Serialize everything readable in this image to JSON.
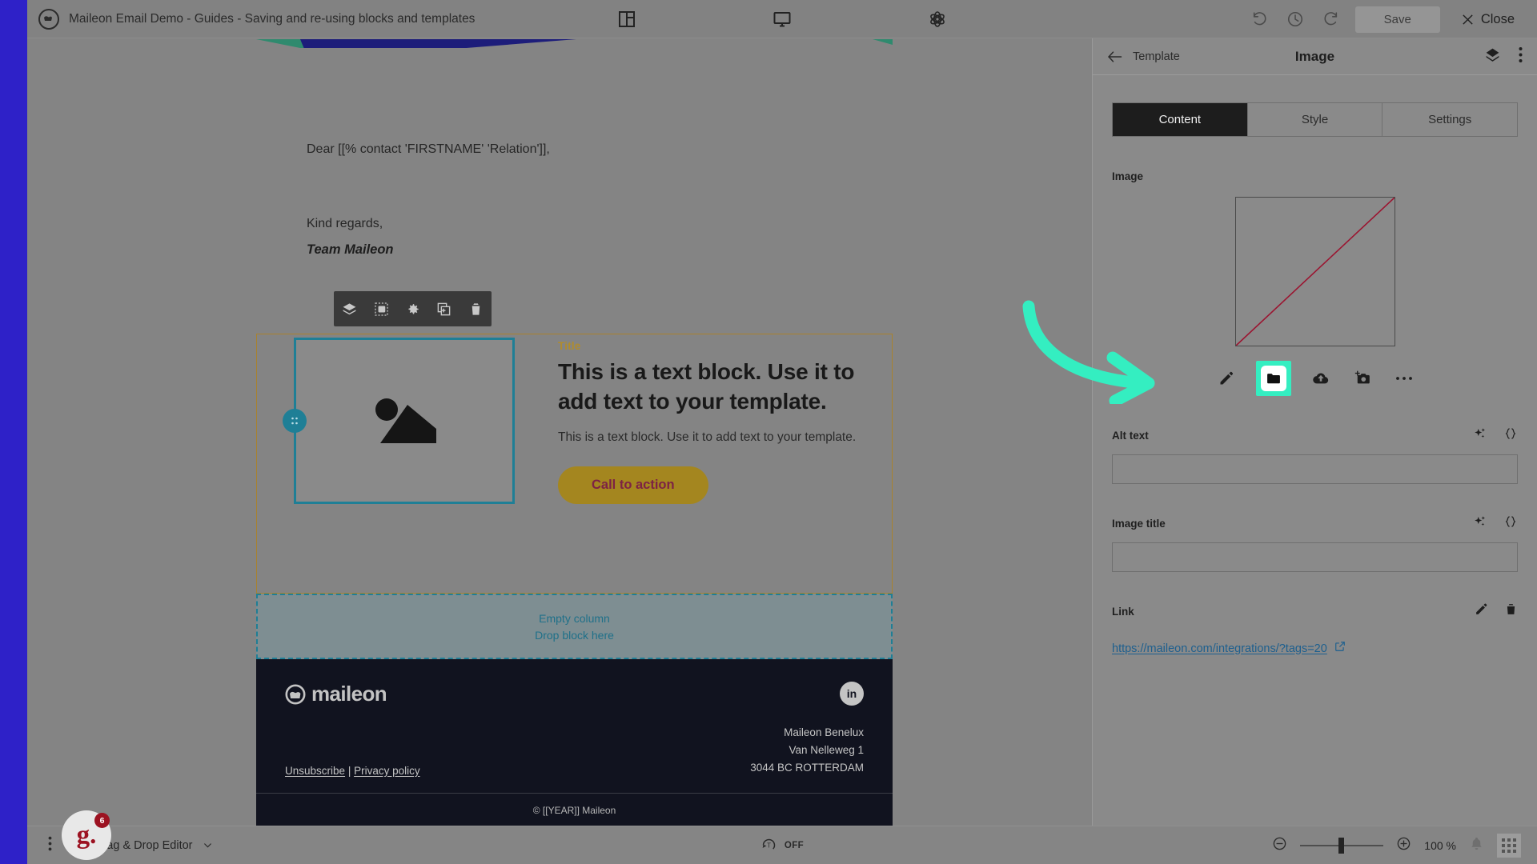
{
  "topbar": {
    "logo_icon": "maileon-logo-icon",
    "document_title": "Maileon Email Demo - Guides - Saving and re-using blocks and templates",
    "center_icons": [
      {
        "name": "layout-grid-icon"
      },
      {
        "name": "desktop-preview-icon"
      },
      {
        "name": "atom-icon"
      }
    ],
    "undo_icon": "undo-icon",
    "history_icon": "clock-history-icon",
    "redo_icon": "redo-icon",
    "save_label": "Save",
    "close_label": "Close",
    "close_icon": "close-x-icon"
  },
  "email": {
    "greeting": "Dear [[% contact 'FIRSTNAME' 'Relation']],",
    "regards": "Kind regards,",
    "signature": "Team Maileon",
    "block_toolbar_icons": [
      {
        "name": "layers-icon"
      },
      {
        "name": "select-block-icon"
      },
      {
        "name": "gear-icon"
      },
      {
        "name": "duplicate-icon"
      },
      {
        "name": "trash-icon"
      }
    ],
    "text_block": {
      "eyebrow": "Title",
      "heading": "This is a text block. Use it to add text to your template.",
      "body": "This is a text block. Use it to add text to your template.",
      "cta_label": "Call to action"
    },
    "empty_column": {
      "line1": "Empty column",
      "line2": "Drop block here"
    },
    "footer": {
      "logo_text": "maileon",
      "social_icon": "linkedin-icon",
      "social_label": "in",
      "unsubscribe_label": "Unsubscribe",
      "separator": "|",
      "privacy_label": "Privacy policy",
      "address": [
        "Maileon Benelux",
        "Van Nelleweg 1",
        "3044 BC  ROTTERDAM"
      ],
      "copyright": "© [[YEAR]] Maileon"
    }
  },
  "panel": {
    "back_label": "Template",
    "back_icon": "arrow-left-icon",
    "title": "Image",
    "layers_icon": "layers-diamond-icon",
    "more_icon": "kebab-menu-icon",
    "tabs": [
      {
        "label": "Content",
        "active": true
      },
      {
        "label": "Style",
        "active": false
      },
      {
        "label": "Settings",
        "active": false
      }
    ],
    "image_label": "Image",
    "image_preview": {
      "state": "broken-image",
      "diagonal_color": "#9b1430",
      "border_color": "#4a4a4a"
    },
    "image_actions": [
      {
        "name": "pencil-edit-icon",
        "highlighted": false
      },
      {
        "name": "folder-browse-icon",
        "highlighted": true
      },
      {
        "name": "cloud-upload-icon",
        "highlighted": false
      },
      {
        "name": "add-photo-camera-icon",
        "highlighted": false
      },
      {
        "name": "more-dots-icon",
        "highlighted": false
      }
    ],
    "alt_text": {
      "label": "Alt text",
      "value": "",
      "placeholder": "",
      "ai_icon": "ai-sparkle-icon",
      "code_icon": "curly-braces-icon"
    },
    "image_title": {
      "label": "Image title",
      "value": "",
      "placeholder": "",
      "ai_icon": "ai-sparkle-icon",
      "code_icon": "curly-braces-icon"
    },
    "link": {
      "label": "Link",
      "edit_icon": "pencil-edit-icon",
      "delete_icon": "trash-icon",
      "url": "https://maileon.com/integrations/?tags=20",
      "external_icon": "external-link-icon"
    }
  },
  "bottombar": {
    "menu_icon": "kebab-menu-icon",
    "editor_icon": "drag-drop-block-icon",
    "editor_label": "Drag & Drop Editor",
    "editor_chevron": "chevron-down-icon",
    "text_toggle_icon": "text-toggle-icon",
    "text_toggle_state": "OFF",
    "zoom_out_icon": "zoom-out-icon",
    "zoom_in_icon": "zoom-in-icon",
    "zoom_level": "100 %",
    "bell_icon": "bell-icon",
    "apps_icon": "apps-grid-icon"
  },
  "overlay": {
    "help_badge": {
      "letter": "g.",
      "count": "6"
    },
    "annotation_arrow_color": "#34eec1",
    "highlight_color": "#34eec1"
  },
  "colors": {
    "accent_teal": "#1f7f96",
    "gold": "#a4861f",
    "cta_text": "#7d2244",
    "dark_footer": "#11131f",
    "page_border": "#2e21c8"
  }
}
